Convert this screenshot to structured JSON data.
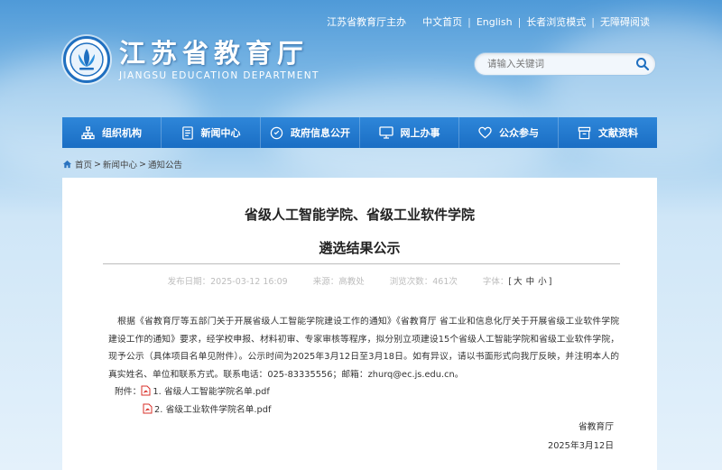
{
  "top_links": {
    "host": "江苏省教育厅主办",
    "chinese": "中文首页",
    "english": "English",
    "elder_mode": "长者浏览模式",
    "accessibility": "无障碍阅读"
  },
  "logo": {
    "name_cn": "江苏省教育厅",
    "name_en": "JIANGSU EDUCATION DEPARTMENT"
  },
  "search": {
    "placeholder": "请输入关键词"
  },
  "nav": [
    {
      "label": "组织机构",
      "icon": "org-chart-icon"
    },
    {
      "label": "新闻中心",
      "icon": "document-icon"
    },
    {
      "label": "政府信息公开",
      "icon": "info-disclosure-icon"
    },
    {
      "label": "网上办事",
      "icon": "monitor-icon"
    },
    {
      "label": "公众参与",
      "icon": "heart-icon"
    },
    {
      "label": "文献资料",
      "icon": "archive-icon"
    }
  ],
  "breadcrumb": [
    "首页",
    "新闻中心",
    "通知公告"
  ],
  "article": {
    "title_line1": "省级人工智能学院、省级工业软件学院",
    "title_line2": "遴选结果公示",
    "meta": {
      "date_label": "发布日期：",
      "date": "2025-03-12 16:09",
      "source_label": "来源：",
      "source": "高教处",
      "views_label": "浏览次数：",
      "views": "461次",
      "fontsize_label": "字体：",
      "size_large": "大",
      "size_medium": "中",
      "size_small": "小"
    },
    "body": "根据《省教育厅等五部门关于开展省级人工智能学院建设工作的通知》《省教育厅 省工业和信息化厅关于开展省级工业软件学院建设工作的通知》要求，经学校申报、材料初审、专家审核等程序，拟分别立项建设15个省级人工智能学院和省级工业软件学院，现予公示（具体项目名单见附件）。公示时间为2025年3月12日至3月18日。如有异议，请以书面形式向我厅反映，并注明本人的真实姓名、单位和联系方式。联系电话：025-83335556；邮箱：zhurq@ec.js.edu.cn。",
    "attachments_label": "附件：",
    "attachments": [
      "1. 省级人工智能学院名单.pdf",
      "2. 省级工业软件学院名单.pdf"
    ],
    "signature": "省教育厅",
    "sign_date": "2025年3月12日"
  },
  "colors": {
    "nav_bg": "#1f76ca",
    "sky_top": "#4f9ad8",
    "pdf_red": "#d9302a"
  }
}
